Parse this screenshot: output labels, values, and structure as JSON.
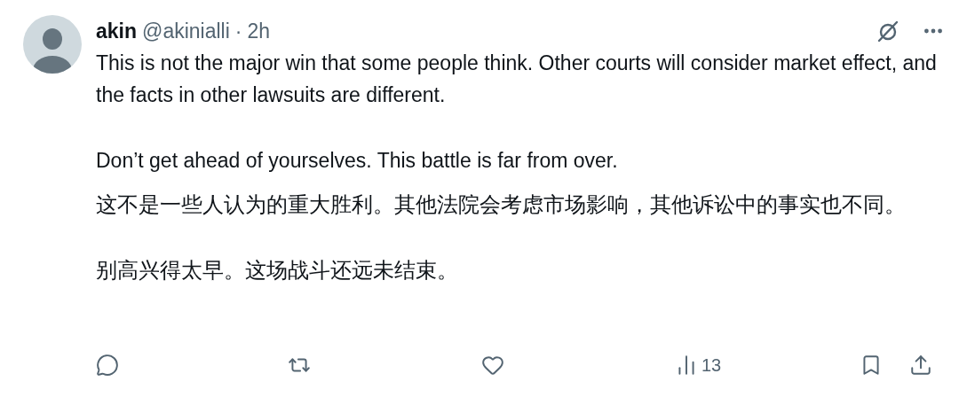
{
  "post": {
    "author": "akin",
    "handle": "@akinialli",
    "separator": "·",
    "time": "2h",
    "paragraphs": [
      "This is not the major win that some people think. Other courts will consider market effect, and the facts in other lawsuits are different.",
      "Don’t get ahead of yourselves. This battle is far from over."
    ],
    "translation": [
      "这不是一些人认为的重大胜利。其他法院会考虑市场影响，其他诉讼中的事实也不同。",
      "别高兴得太早。这场战斗还远未结束。"
    ],
    "actions": [
      {
        "kind": "reply"
      },
      {
        "kind": "repost"
      },
      {
        "kind": "like"
      },
      {
        "kind": "views",
        "count": "13"
      },
      {
        "kind": "bookmark"
      },
      {
        "kind": "share"
      }
    ]
  }
}
